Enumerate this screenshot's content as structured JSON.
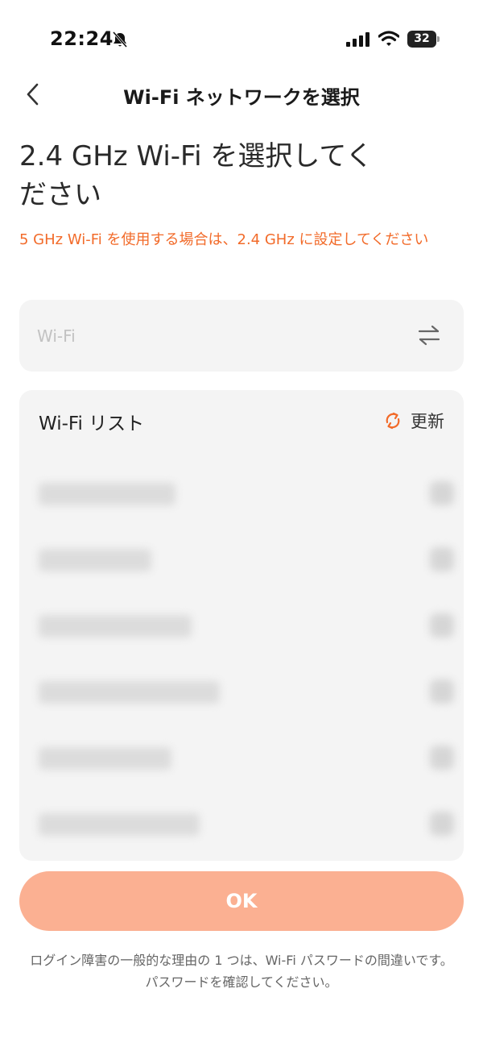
{
  "status_bar": {
    "time": "22:24",
    "battery_level": "32"
  },
  "header": {
    "title": "Wi-Fi ネットワークを選択"
  },
  "main": {
    "heading": "2.4 GHz Wi-Fi を選択してください",
    "warning": "5 GHz Wi-Fi を使用する場合は、2.4 GHz に設定してください"
  },
  "wifi_field": {
    "placeholder": "Wi-Fi",
    "value": "",
    "icon": "swap-arrows-icon"
  },
  "wifi_list": {
    "title": "Wi-Fi リスト",
    "refresh_label": "更新",
    "refresh_icon": "refresh-icon",
    "accent_color": "#f26b2a",
    "rows": [
      {
        "name_blurred": true
      },
      {
        "name_blurred": true
      },
      {
        "name_blurred": true
      },
      {
        "name_blurred": true
      },
      {
        "name_blurred": true
      },
      {
        "name_blurred": true
      }
    ]
  },
  "ok_button": {
    "label": "OK",
    "color": "#fbb092"
  },
  "footer": {
    "note": "ログイン障害の一般的な理由の 1 つは、Wi-Fi パスワードの間違いです。パスワードを確認してください。"
  }
}
